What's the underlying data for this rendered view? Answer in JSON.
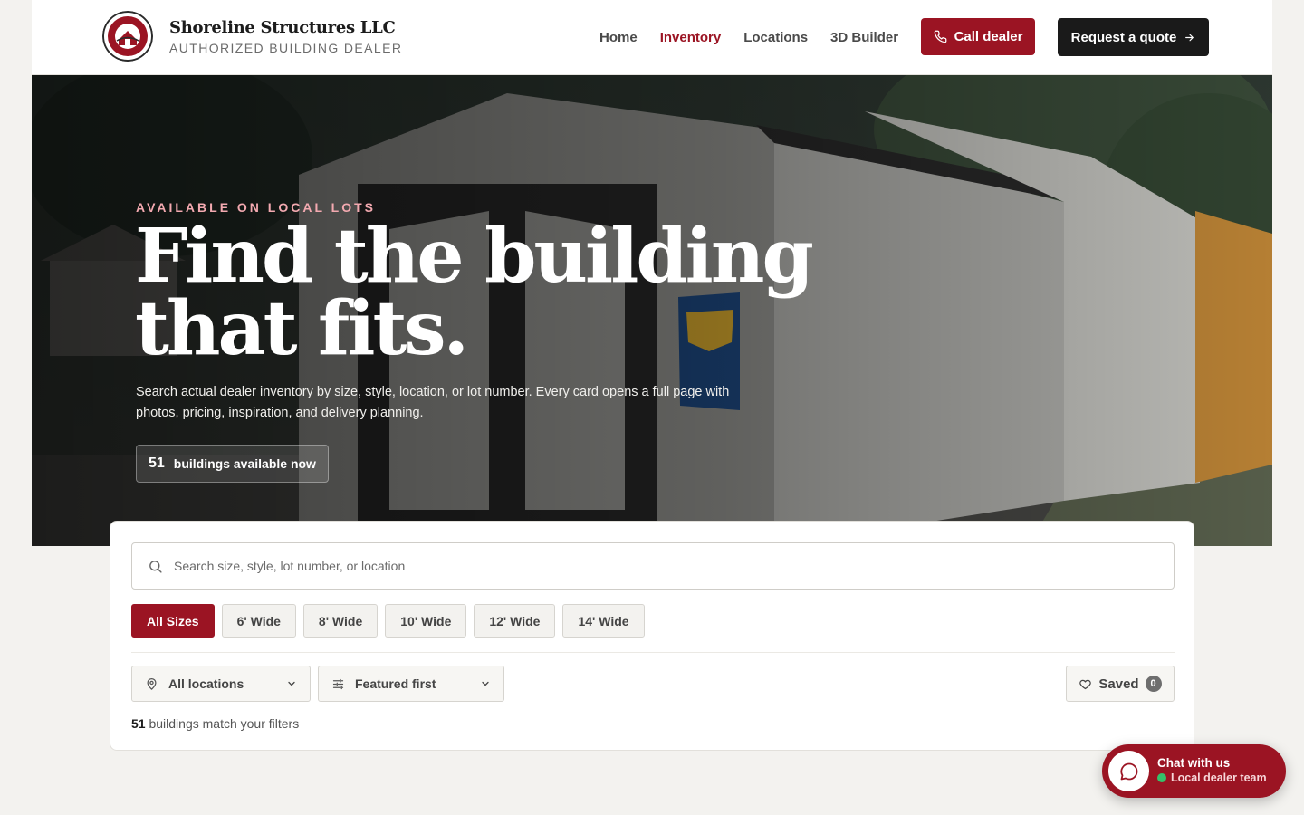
{
  "header": {
    "brand_name": "Shoreline Structures LLC",
    "brand_tagline": "AUTHORIZED BUILDING DEALER",
    "logo_text": "SHORELINE STRUCTURES",
    "nav": [
      {
        "label": "Home",
        "active": false
      },
      {
        "label": "Inventory",
        "active": true
      },
      {
        "label": "Locations",
        "active": false
      },
      {
        "label": "3D Builder",
        "active": false
      }
    ],
    "call_label": "Call dealer",
    "quote_label": "Request a quote"
  },
  "hero": {
    "eyebrow": "AVAILABLE ON LOCAL LOTS",
    "headline_line1": "Find the building",
    "headline_line2": "that fits.",
    "description": "Search actual dealer inventory by size, style, location, or lot number. Every card opens a full page with photos, pricing, inspiration, and delivery planning.",
    "available_count": "51",
    "available_label": "buildings available now"
  },
  "filters": {
    "search_placeholder": "Search size, style, lot number, or location",
    "size_chips": [
      {
        "label": "All Sizes",
        "active": true
      },
      {
        "label": "6' Wide",
        "active": false
      },
      {
        "label": "8' Wide",
        "active": false
      },
      {
        "label": "10' Wide",
        "active": false
      },
      {
        "label": "12' Wide",
        "active": false
      },
      {
        "label": "14' Wide",
        "active": false
      }
    ],
    "location_select": "All locations",
    "sort_select": "Featured first",
    "saved_label": "Saved",
    "saved_count": "0",
    "match_count": "51",
    "match_label": "buildings match your filters"
  },
  "chat": {
    "title": "Chat with us",
    "subtitle": "Local dealer team"
  },
  "colors": {
    "accent": "#9b1423",
    "dark": "#1a1a1a",
    "background": "#f3f2ef",
    "online": "#35c26a"
  }
}
